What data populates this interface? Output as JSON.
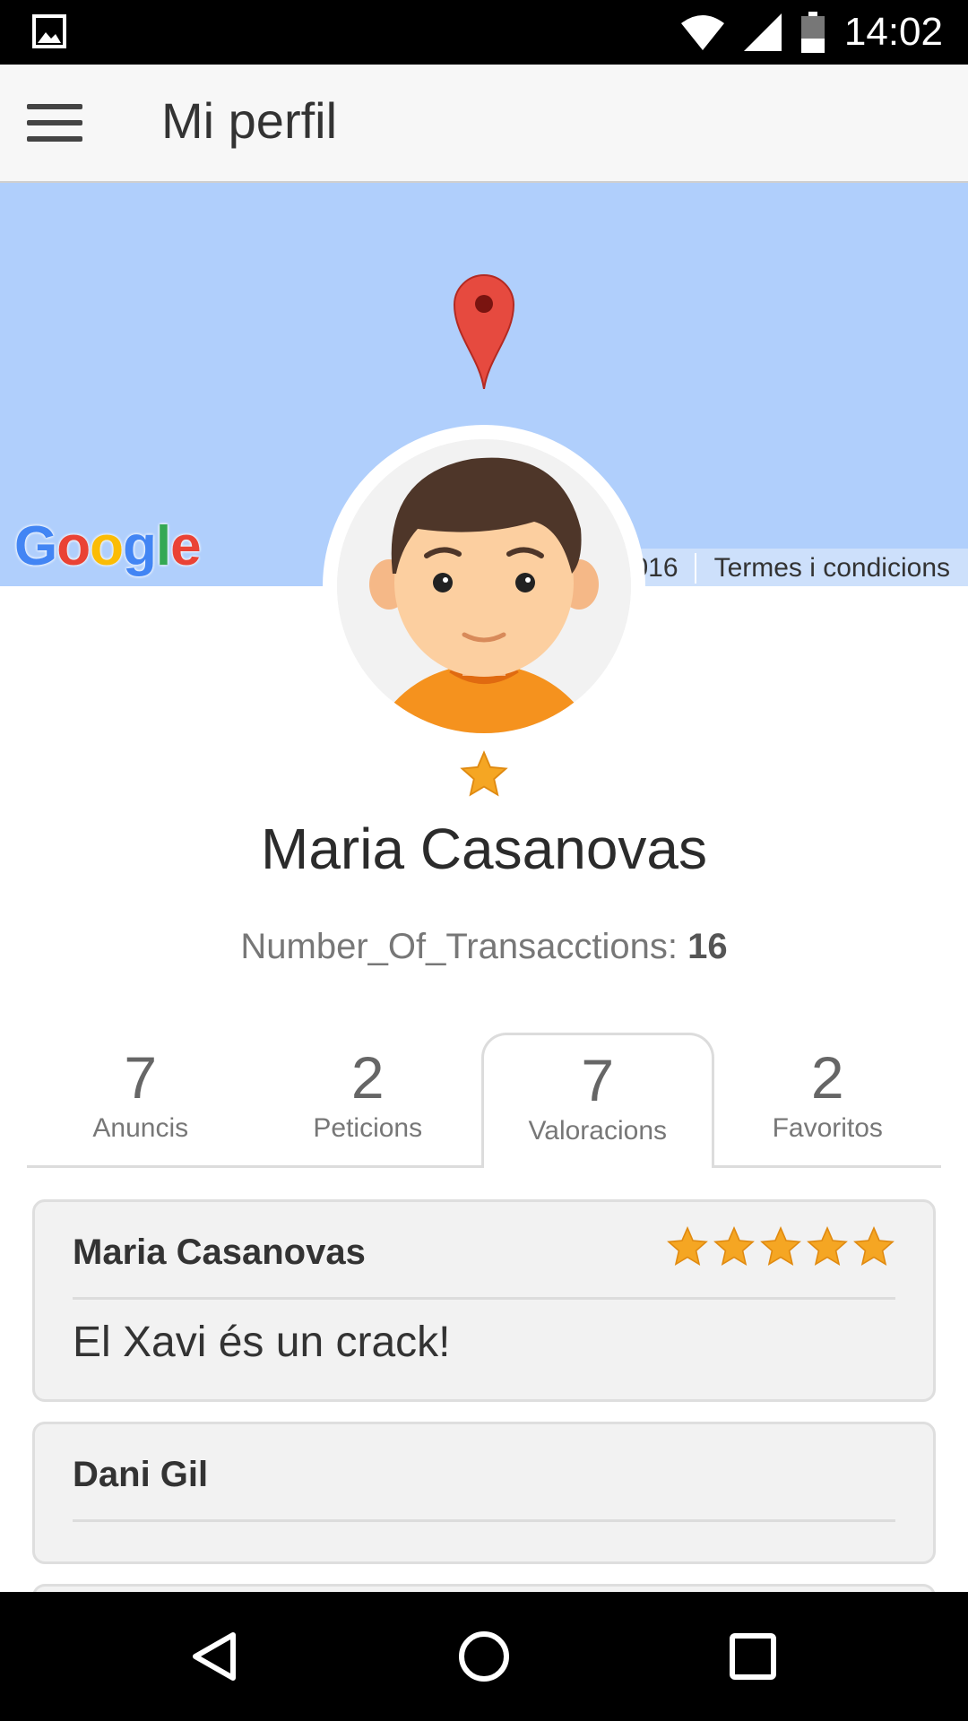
{
  "status_bar": {
    "time": "14:02",
    "icons": [
      "gallery-icon",
      "wifi-icon",
      "cell-signal-icon",
      "battery-icon"
    ]
  },
  "app_bar": {
    "title": "Mi perfil",
    "menu_icon": "hamburger-menu-icon"
  },
  "map": {
    "logo_text": "Google",
    "copyright_fragment": "016",
    "terms_label": "Termes i condicions",
    "background_color": "#b0cffc"
  },
  "profile": {
    "name": "Maria Casanovas",
    "rating_stars": 1,
    "transactions_label": "Number_Of_Transacctions:",
    "transactions_value": "16"
  },
  "tabs": [
    {
      "count": "7",
      "label": "Anuncis"
    },
    {
      "count": "2",
      "label": "Peticions"
    },
    {
      "count": "7",
      "label": "Valoracions",
      "active": true
    },
    {
      "count": "2",
      "label": "Favoritos"
    }
  ],
  "reviews": [
    {
      "author": "Maria Casanovas",
      "stars": 5,
      "text": "El Xavi és un crack!"
    },
    {
      "author": "Dani Gil",
      "stars": 0,
      "text": ""
    }
  ],
  "nav_bar": {
    "icons": [
      "back-icon",
      "home-icon",
      "recents-icon"
    ]
  },
  "colors": {
    "star": "#f5a623",
    "pin": "#e64a3f",
    "shirt": "#f5921e",
    "hair": "#4e3629",
    "skin": "#fccfa0"
  }
}
